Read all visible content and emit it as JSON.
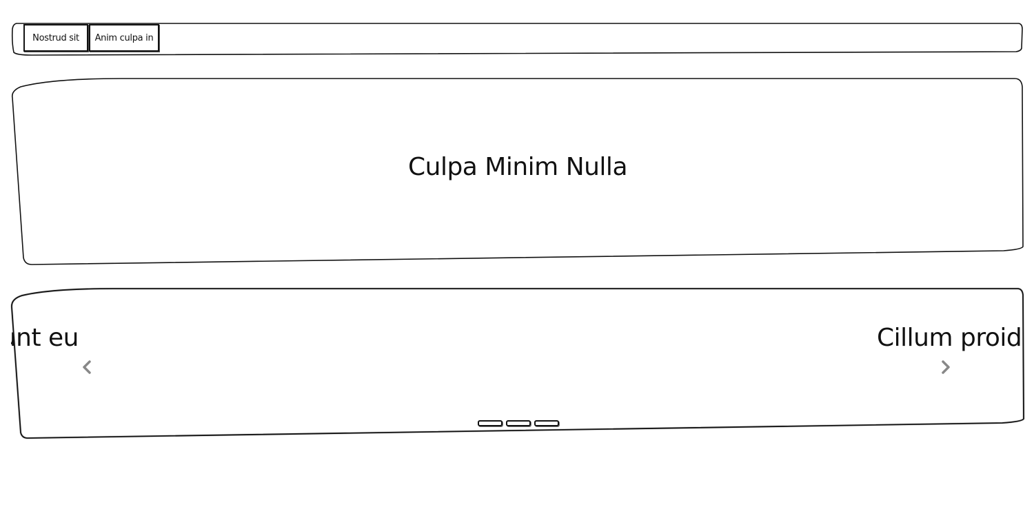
{
  "tabs": [
    {
      "label": "Nostrud sit"
    },
    {
      "label": "Anim culpa in"
    }
  ],
  "hero": {
    "title": "Culpa Minim Nulla"
  },
  "carousel": {
    "prev_slide_text": "unt eu",
    "next_slide_text": "Cillum proide",
    "prev_icon": "chevron-left-icon",
    "next_icon": "chevron-right-icon",
    "indicator_count": 3
  }
}
